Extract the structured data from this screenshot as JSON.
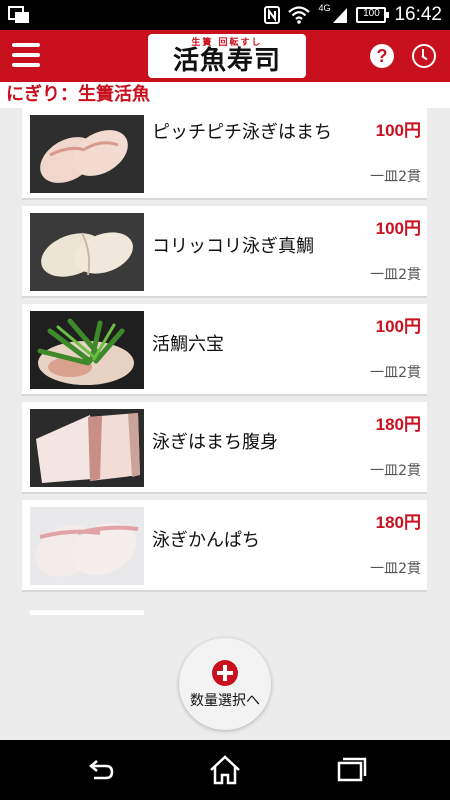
{
  "status": {
    "time": "16:42",
    "battery": "100",
    "network": "4G"
  },
  "header": {
    "logo_sub": "生簀 回転すし",
    "logo_main": "活魚寿司",
    "help_label": "?"
  },
  "category": {
    "title": "にぎり：生簀活魚"
  },
  "items": [
    {
      "name": "ピッチピチ泳ぎはまち",
      "price": "100円",
      "portion": "一皿2貫"
    },
    {
      "name": "コリッコリ泳ぎ真鯛",
      "price": "100円",
      "portion": "一皿2貫"
    },
    {
      "name": "活鯛六宝",
      "price": "100円",
      "portion": "一皿2貫"
    },
    {
      "name": "泳ぎはまち腹身",
      "price": "180円",
      "portion": "一皿2貫"
    },
    {
      "name": "泳ぎかんぱち",
      "price": "180円",
      "portion": "一皿2貫"
    }
  ],
  "quantity_button": {
    "label": "数量選択へ"
  },
  "colors": {
    "brand_red": "#c8101e"
  }
}
